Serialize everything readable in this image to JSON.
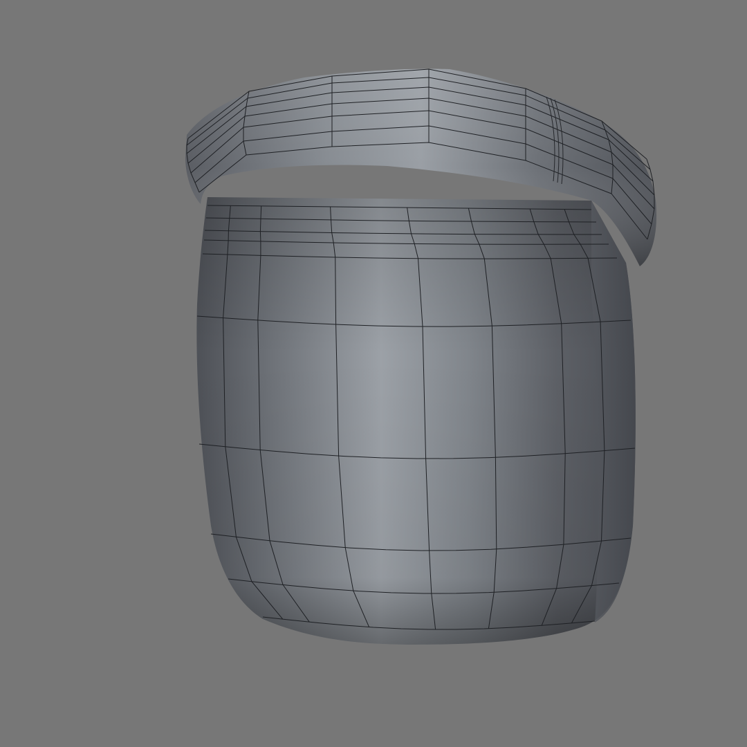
{
  "viewport": {
    "background": "#777777",
    "model": {
      "type": "sack-wireframe",
      "shading": "gray",
      "wire_color": "#1e2024",
      "base_light": "#9ea3a9",
      "base_dark": "#4a4d53"
    }
  }
}
